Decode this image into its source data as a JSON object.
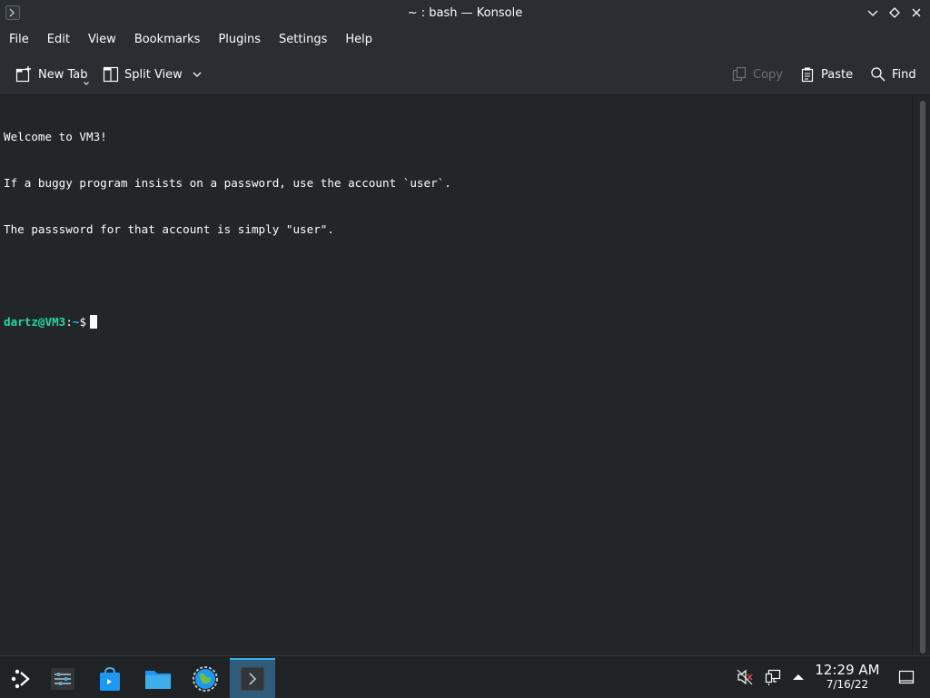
{
  "window": {
    "title": "~ : bash — Konsole",
    "icon": "konsole-icon",
    "buttons": [
      "minimize",
      "maximize",
      "close"
    ]
  },
  "menubar": {
    "items": [
      {
        "label": "File"
      },
      {
        "label": "Edit"
      },
      {
        "label": "View"
      },
      {
        "label": "Bookmarks"
      },
      {
        "label": "Plugins"
      },
      {
        "label": "Settings"
      },
      {
        "label": "Help"
      }
    ]
  },
  "toolbar": {
    "new_tab": "New Tab",
    "split_view": "Split View",
    "copy": "Copy",
    "paste": "Paste",
    "find": "Find"
  },
  "terminal": {
    "lines": [
      "Welcome to VM3!",
      "If a buggy program insists on a password, use the account `user`.",
      "The passsword for that account is simply \"user\"."
    ],
    "prompt": {
      "user_host": "dartz@VM3",
      "separator": ":",
      "path": "~",
      "symbol": "$"
    }
  },
  "taskbar": {
    "launchers": [
      "app-launcher-icon",
      "system-settings-icon",
      "discover-store-icon",
      "file-manager-icon",
      "web-browser-icon",
      "konsole-icon"
    ],
    "tray": [
      "audio-muted-icon",
      "network-wired-icon",
      "show-hidden-arrow-icon"
    ],
    "clock": {
      "time": "12:29 AM",
      "date": "7/16/22"
    },
    "show_desktop": "show-desktop-icon"
  },
  "colors": {
    "accent": "#3daee9",
    "prompt_user": "#1cdc9a",
    "background": "#232629",
    "chrome": "#2a2e32"
  }
}
